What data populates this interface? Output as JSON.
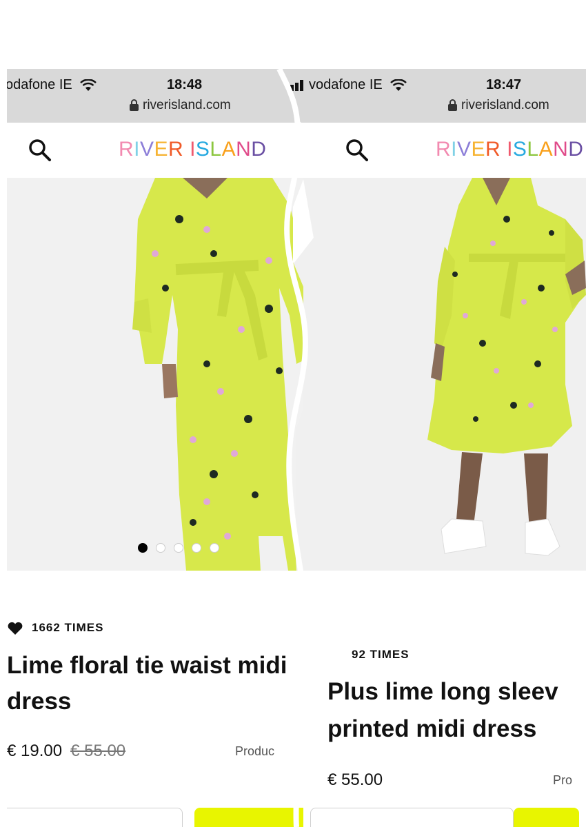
{
  "left": {
    "carrier": "odafone IE",
    "time": "18:48",
    "url": "riverisland.com",
    "logo": [
      "R",
      "I",
      "V",
      "E",
      "R",
      " ",
      "I",
      "S",
      "L",
      "A",
      "N",
      "D"
    ],
    "favourites": "1662 TIMES",
    "title_line1": "Lime floral tie waist midi",
    "title_line2": "dress",
    "price": "€ 19.00",
    "old_price": "€ 55.00",
    "product_code_label": "Produc"
  },
  "right": {
    "carrier": "vodafone IE",
    "time": "18:47",
    "url": "riverisland.com",
    "logo": [
      "R",
      "I",
      "V",
      "E",
      "R",
      " ",
      "I",
      "S",
      "L",
      "A",
      "N",
      "D"
    ],
    "favourites": "92 TIMES",
    "title_line1": "Plus lime long sleev",
    "title_line2": "printed midi dress",
    "price": "€ 55.00",
    "product_code_label": "Pro"
  },
  "logo_colors": [
    "#f28ab0",
    "#7fd1e6",
    "#8c7ed8",
    "#f6b331",
    "#f05a28",
    "#ffffff",
    "#f05a6e",
    "#26a9e0",
    "#8cc63f",
    "#f9a01b",
    "#e04b8a",
    "#6a4fa3"
  ],
  "colors": {
    "accent_yellow": "#e8f500",
    "dress_lime": "#d7e84b"
  },
  "icons": [
    "wifi-icon",
    "signal-icon",
    "lock-icon",
    "search-icon",
    "heart-icon"
  ]
}
